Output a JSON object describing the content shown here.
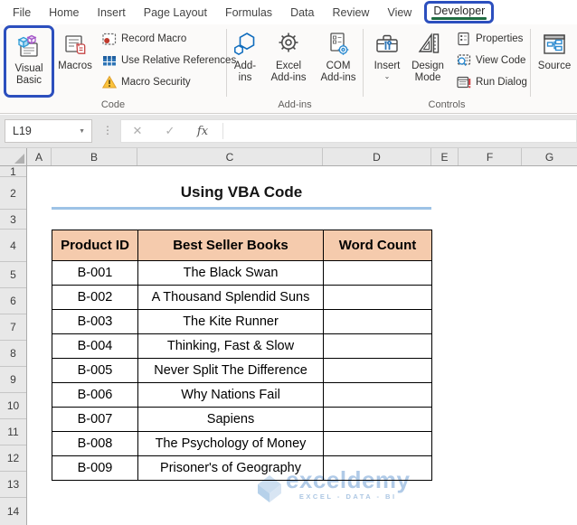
{
  "tab_bar": {
    "tabs": [
      "File",
      "Home",
      "Insert",
      "Page Layout",
      "Formulas",
      "Data",
      "Review",
      "View",
      "Developer"
    ],
    "active_tab": "Developer"
  },
  "ribbon": {
    "code_group": {
      "label": "Code",
      "visual_basic_label": "Visual Basic",
      "macros_label": "Macros",
      "record_macro": "Record Macro",
      "use_relative_references": "Use Relative References",
      "macro_security": "Macro Security"
    },
    "addins_group": {
      "label": "Add-ins",
      "addins_label": "Add-ins",
      "excel_addins_label": "Excel Add-ins",
      "com_addins_label": "COM Add-ins"
    },
    "controls_group": {
      "label": "Controls",
      "insert_label": "Insert",
      "design_mode_label": "Design Mode",
      "properties": "Properties",
      "view_code": "View Code",
      "run_dialog": "Run Dialog"
    },
    "xml_group": {
      "source_label": "Source"
    }
  },
  "formula_bar": {
    "name_box": "L19",
    "fx_symbol": "fx",
    "cancel_glyph": "✕",
    "enter_glyph": "✓",
    "formula_value": ""
  },
  "sheet": {
    "column_headers": [
      "A",
      "B",
      "C",
      "D",
      "E",
      "F",
      "G"
    ],
    "row_numbers": [
      "1",
      "2",
      "3",
      "4",
      "5",
      "6",
      "7",
      "8",
      "9",
      "10",
      "11",
      "12",
      "13",
      "14"
    ],
    "title": "Using VBA Code",
    "table": {
      "headers": [
        "Product ID",
        "Best Seller Books",
        "Word Count"
      ],
      "rows": [
        {
          "product_id": "B-001",
          "book": "The Black Swan",
          "word_count": ""
        },
        {
          "product_id": "B-002",
          "book": "A Thousand Splendid Suns",
          "word_count": ""
        },
        {
          "product_id": "B-003",
          "book": "The Kite Runner",
          "word_count": ""
        },
        {
          "product_id": "B-004",
          "book": "Thinking, Fast & Slow",
          "word_count": ""
        },
        {
          "product_id": "B-005",
          "book": "Never Split The Difference",
          "word_count": ""
        },
        {
          "product_id": "B-006",
          "book": "Why Nations Fail",
          "word_count": ""
        },
        {
          "product_id": "B-007",
          "book": "Sapiens",
          "word_count": ""
        },
        {
          "product_id": "B-008",
          "book": "The Psychology of Money",
          "word_count": ""
        },
        {
          "product_id": "B-009",
          "book": "Prisoner's of Geography",
          "word_count": ""
        }
      ]
    },
    "watermark": {
      "name": "exceldemy",
      "tagline": "EXCEL - DATA - BI"
    }
  },
  "colors": {
    "highlight_blue": "#2C4FBE",
    "developer_underline_green": "#1E6B41",
    "table_header_fill": "#F5CBAD",
    "title_underline_blue": "#9DC3E6"
  }
}
